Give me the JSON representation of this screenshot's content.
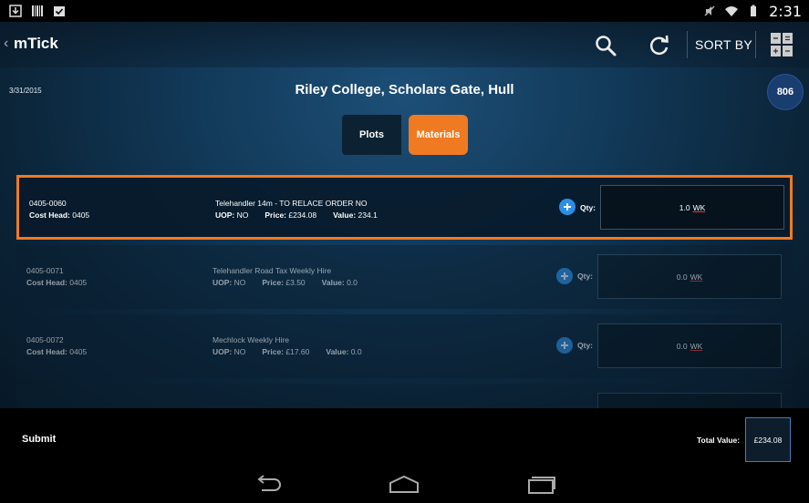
{
  "status_bar": {
    "time": "2:31"
  },
  "action_bar": {
    "title": "mTick",
    "sort_label": "SORT BY"
  },
  "header": {
    "date": "3/31/2015",
    "site_title": "Riley College, Scholars Gate, Hull",
    "badge_count": "806"
  },
  "tabs": [
    {
      "label": "Plots",
      "active": false
    },
    {
      "label": "Materials",
      "active": true
    }
  ],
  "items": [
    {
      "code": "0405-0060",
      "cost_head_label": "Cost Head:",
      "cost_head": "0405",
      "description": "Telehandler 14m - TO RELACE ORDER NO",
      "uop_label": "UOP:",
      "uop": "NO",
      "price_label": "Price:",
      "price": "£234.08",
      "value_label": "Value:",
      "value": "234.1",
      "qty_label": "Qty:",
      "qty": "1.0",
      "unit": "WK"
    },
    {
      "code": "0405-0071",
      "cost_head_label": "Cost Head:",
      "cost_head": "0405",
      "description": "Telehandler Road Tax Weekly Hire",
      "uop_label": "UOP:",
      "uop": "NO",
      "price_label": "Price:",
      "price": "£3.50",
      "value_label": "Value:",
      "value": "0.0",
      "qty_label": "Qty:",
      "qty": "0.0",
      "unit": "WK"
    },
    {
      "code": "0405-0072",
      "cost_head_label": "Cost Head:",
      "cost_head": "0405",
      "description": "Mechlock Weekly Hire",
      "uop_label": "UOP:",
      "uop": "NO",
      "price_label": "Price:",
      "price": "£17.60",
      "value_label": "Value:",
      "value": "0.0",
      "qty_label": "Qty:",
      "qty": "0.0",
      "unit": "WK"
    }
  ],
  "footer": {
    "submit_label": "Submit",
    "total_label": "Total Value:",
    "total_value": "£234.08"
  },
  "colors": {
    "accent": "#f07a22",
    "plus_button": "#2b8fe6",
    "badge": "#1a3d70"
  }
}
